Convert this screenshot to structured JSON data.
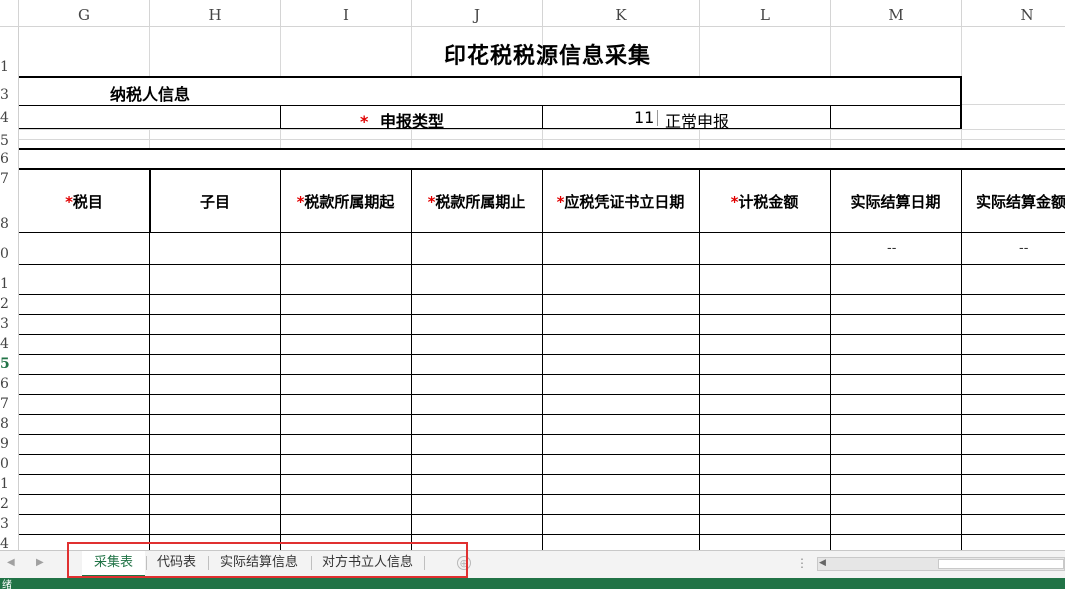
{
  "columns": [
    "G",
    "H",
    "I",
    "J",
    "K",
    "L",
    "M",
    "N"
  ],
  "rows": [
    "1",
    "3",
    "4",
    "5",
    "6",
    "7",
    "8",
    "0",
    "1",
    "2",
    "3",
    "4",
    "5",
    "6",
    "7",
    "8",
    "9",
    "0",
    "1",
    "2",
    "3",
    "4"
  ],
  "active_row": "5",
  "sheet": {
    "title": "印花税税源信息采集",
    "taxpayer_info": "纳税人信息",
    "required_mark": "*",
    "declare_type_label": "申报类型",
    "declare_type_code": "11",
    "declare_type_value": "正常申报",
    "headers": [
      {
        "star": "*",
        "label": "税目"
      },
      {
        "star": "",
        "label": "子目"
      },
      {
        "star": "*",
        "label": "税款所属期起"
      },
      {
        "star": "*",
        "label": "税款所属期止"
      },
      {
        "star": "*",
        "label": "应税凭证书立日期"
      },
      {
        "star": "*",
        "label": "计税金额"
      },
      {
        "star": "",
        "label": "实际结算日期"
      },
      {
        "star": "",
        "label": "实际结算金额"
      }
    ],
    "dash_m": "--",
    "dash_n": "--"
  },
  "tabs": [
    "采集表",
    "代码表",
    "实际结算信息",
    "对方书立人信息"
  ],
  "active_tab": "采集表",
  "add_sheet_icon": "⊕",
  "status": "绪",
  "colors": {
    "accent": "#217346",
    "highlight": "#e03030",
    "required": "#e00000"
  }
}
